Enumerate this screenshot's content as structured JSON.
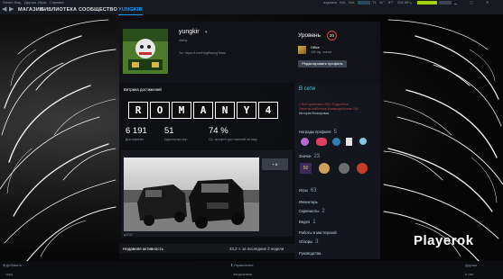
{
  "colors": {
    "accent": "#1a9fff",
    "level_ring": "#d04b3b",
    "header_bg": "#171a21"
  },
  "nav": {
    "items": [
      "МАГАЗИН",
      "БИБЛИОТЕКА",
      "СООБЩЕСТВО",
      "YUNGKIR"
    ]
  },
  "top_strip": {
    "menu": [
      "Steam",
      "Вид",
      "Друзья",
      "Игры",
      "Справка"
    ],
    "hud_label": "надпись",
    "hud_values": [
      "N/A",
      "N/A"
    ]
  },
  "hud_right": {
    "items": [
      "T1",
      "T2",
      "T3",
      "T4"
    ],
    "values": [
      "11°",
      "87°",
      "255 МГц"
    ]
  },
  "profile": {
    "name": "yungkir",
    "real_name": "vkrby",
    "url": "Tw: https://t.me/HogRacingTeam",
    "level_label": "Уровень",
    "level": "20",
    "badge_name": "Office",
    "badge_xp": "100 ед. опыта",
    "edit_button": "Редактировать профиль"
  },
  "showcase": {
    "title": "Витрина достижений",
    "letters": [
      "R",
      "O",
      "M",
      "A",
      "N",
      "Y",
      "4"
    ],
    "stats": [
      {
        "value": "6 191",
        "label": "Достижения"
      },
      {
        "value": "51",
        "label": "Идеальных игр"
      },
      {
        "value": "74 %",
        "label": "Ср. процент достижений за игру"
      }
    ]
  },
  "screenshot": {
    "more": "+ 8",
    "caption": "q4747"
  },
  "activity": {
    "title": "Недавняя активность",
    "hours": "23,2 ч. за последние 2 недели"
  },
  "sidebar": {
    "status": "В сети",
    "status_lines": [
      "1 Всё правильно 2021 Подробнее",
      "Заметки шаблонов Взаимодействие 100",
      "История блокировок"
    ],
    "badges_label": "Награды профиля",
    "badges_count": "5",
    "icons_label": "Значки",
    "icons_count": "23",
    "links": [
      {
        "label": "Игры",
        "count": "63"
      },
      {
        "label": "Инвентарь",
        "count": ""
      },
      {
        "label": "Скриншоты",
        "count": "2"
      },
      {
        "label": "Видео",
        "count": "1"
      },
      {
        "label": "Работы в мастерской",
        "count": ""
      },
      {
        "label": "Обзоры",
        "count": "3"
      },
      {
        "label": "Руководства",
        "count": ""
      }
    ]
  },
  "footer": {
    "left": "Добавить игру",
    "center": "Управление загрузками",
    "right": "Друзья и чат"
  },
  "watermark": "Playerok"
}
